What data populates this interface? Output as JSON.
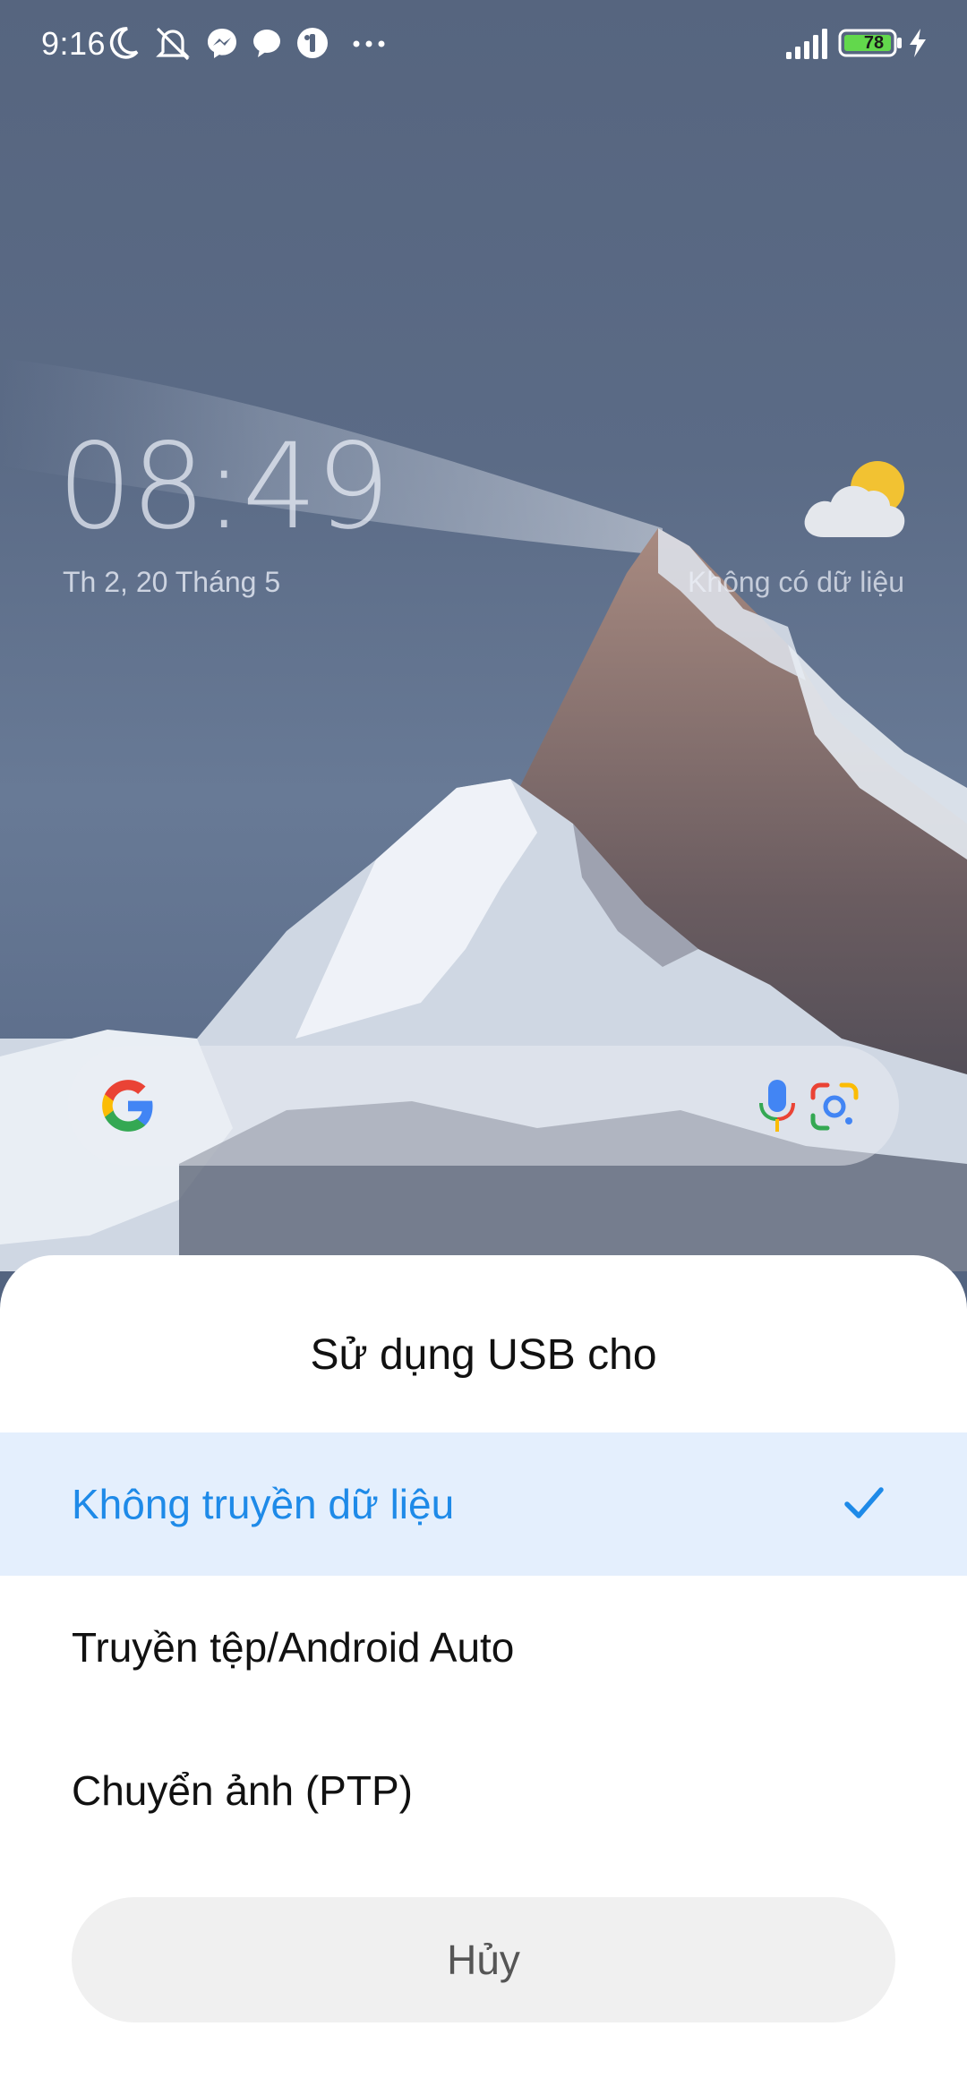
{
  "status_bar": {
    "time": "9:16",
    "battery_level": "78",
    "icons": [
      "moon-icon",
      "mute-icon",
      "messenger-icon",
      "chat-icon",
      "app-icon",
      "more-icon",
      "signal-icon",
      "battery-icon",
      "charging-icon"
    ]
  },
  "home": {
    "clock": "08:49",
    "date": "Th 2, 20 Tháng 5",
    "weather_text": "Không có dữ liệu"
  },
  "search_bar": {
    "icons": [
      "google-logo-icon",
      "mic-icon",
      "lens-icon"
    ]
  },
  "usb_sheet": {
    "title": "Sử dụng USB cho",
    "options": [
      {
        "label": "Không truyền dữ liệu",
        "selected": true
      },
      {
        "label": "Truyền tệp/Android Auto",
        "selected": false
      },
      {
        "label": "Chuyển ảnh (PTP)",
        "selected": false
      }
    ],
    "cancel_label": "Hủy"
  },
  "colors": {
    "accent": "#1e8ae8",
    "selected_bg": "#e4effd",
    "cancel_bg": "#f0f0f0"
  }
}
